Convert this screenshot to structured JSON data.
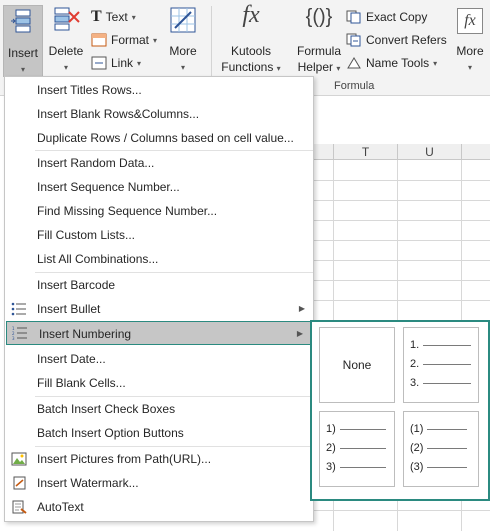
{
  "ribbon": {
    "insert": {
      "label": "Insert",
      "caret": "▾"
    },
    "delete": {
      "label": "Delete",
      "caret": "▾"
    },
    "text": {
      "label": "Text",
      "caret": "▾"
    },
    "format": {
      "label": "Format",
      "caret": "▾"
    },
    "link": {
      "label": "Link",
      "caret": "▾"
    },
    "more1": {
      "label": "More",
      "caret": "▾"
    },
    "kutools_functions": {
      "label1": "Kutools",
      "label2": "Functions",
      "caret": "▾",
      "icon_text": "fx"
    },
    "formula_helper": {
      "label1": "Formula",
      "label2": "Helper",
      "caret": "▾",
      "icon_text": "{()}"
    },
    "exact_copy": {
      "label": "Exact Copy"
    },
    "convert_refers": {
      "label": "Convert Refers"
    },
    "name_tools": {
      "label": "Name Tools",
      "caret": "▾"
    },
    "more2": {
      "label": "More",
      "caret": "▾",
      "icon_text": "fx"
    },
    "group_formula": "Formula"
  },
  "sheet": {
    "columns": [
      "T",
      "U"
    ]
  },
  "menu": {
    "items": [
      {
        "label": "Insert Titles Rows..."
      },
      {
        "label": "Insert Blank Rows&Columns..."
      },
      {
        "label": "Duplicate Rows / Columns based on cell value..."
      },
      {
        "label": "Insert Random Data..."
      },
      {
        "label": "Insert Sequence Number..."
      },
      {
        "label": "Find Missing Sequence Number..."
      },
      {
        "label": "Fill Custom Lists..."
      },
      {
        "label": "List All Combinations..."
      },
      {
        "label": "Insert Barcode"
      },
      {
        "label": "Insert Bullet",
        "arrow": "▶"
      },
      {
        "label": "Insert Numbering",
        "arrow": "▶"
      },
      {
        "label": "Insert Date..."
      },
      {
        "label": "Fill Blank Cells..."
      },
      {
        "label": "Batch Insert Check Boxes"
      },
      {
        "label": "Batch Insert Option Buttons"
      },
      {
        "label": "Insert Pictures from Path(URL)..."
      },
      {
        "label": "Insert Watermark..."
      },
      {
        "label": "AutoText"
      }
    ]
  },
  "submenu": {
    "none_label": "None",
    "style_dot": [
      "1.",
      "2.",
      "3."
    ],
    "style_paren": [
      "1)",
      "2)",
      "3)"
    ],
    "style_full_paren": [
      "(1)",
      "(2)",
      "(3)"
    ]
  },
  "colors": {
    "accent": "#2b8a80",
    "active_bg": "#c6c6c6",
    "ribbon_bg": "#f3f3f3"
  }
}
